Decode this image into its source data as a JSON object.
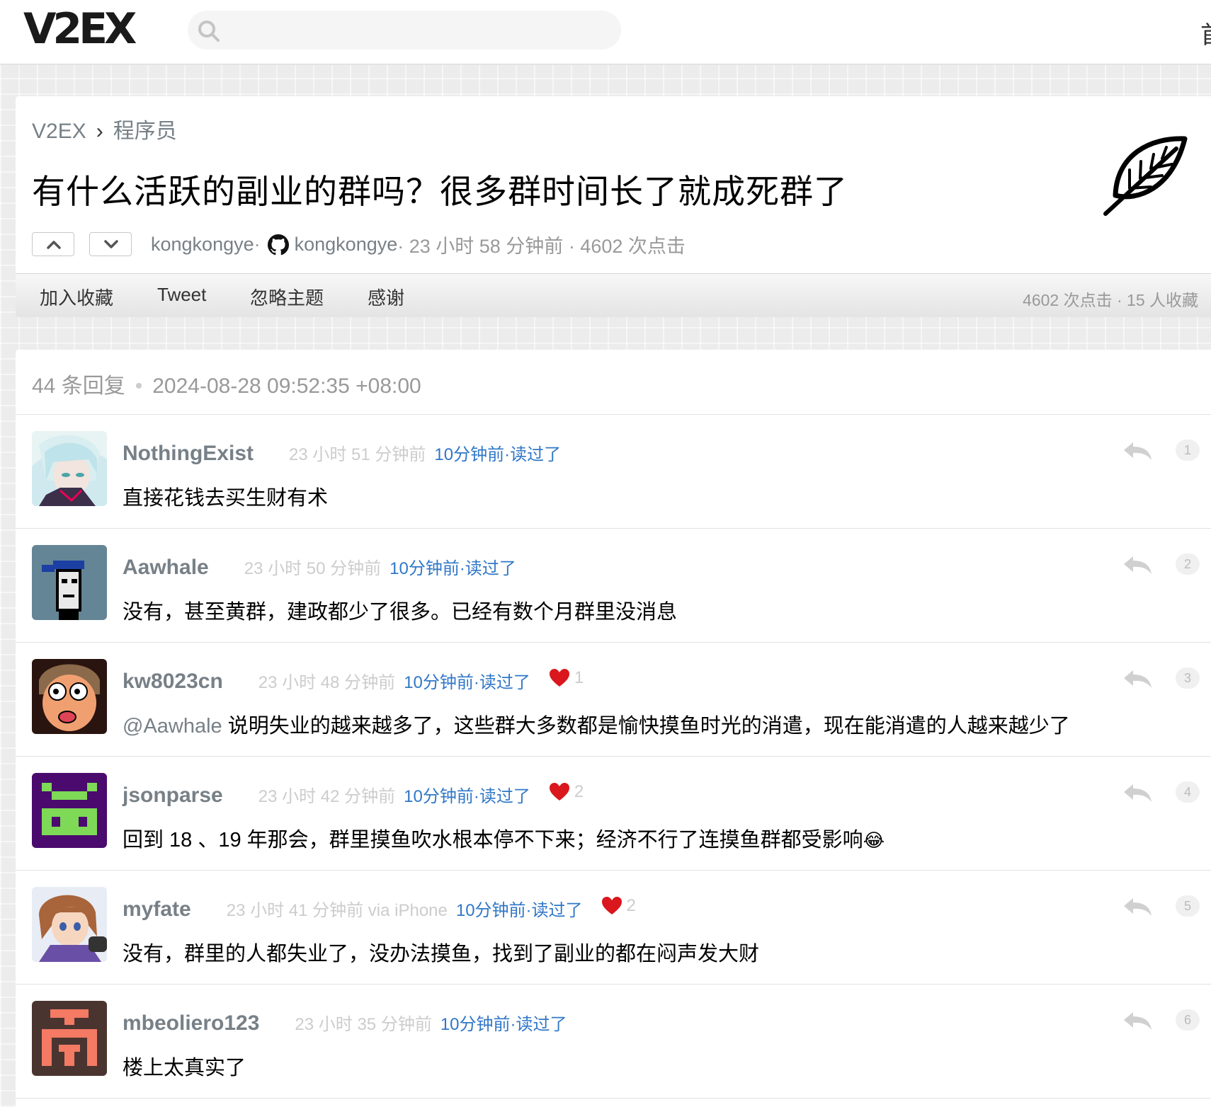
{
  "header": {
    "logo": "V2EX",
    "search_placeholder": "",
    "nav_partial": "首"
  },
  "topic": {
    "breadcrumb_home": "V2EX",
    "breadcrumb_sep": "›",
    "breadcrumb_node": "程序员",
    "title": "有什么活跃的副业的群吗？很多群时间长了就成死群了",
    "author": "kongkongye",
    "github_user": "kongkongye",
    "meta_tail": " · 23 小时 58 分钟前 · 4602 次点击",
    "author_sep": " · ",
    "toolbar": {
      "favorite": "加入收藏",
      "tweet": "Tweet",
      "ignore": "忽略主题",
      "thank": "感谢",
      "stats": "4602 次点击 · 15 人收藏"
    }
  },
  "replies_header": {
    "count": "44 条回复",
    "dot": "•",
    "time": "2024-08-28 09:52:35 +08:00"
  },
  "replies": [
    {
      "user": "NothingExist",
      "time": "23 小时 51 分钟前",
      "read": "10分钟前·读过了",
      "hearts": "",
      "mention": "",
      "content": "直接花钱去买生财有术",
      "num": "1"
    },
    {
      "user": "Aawhale",
      "time": "23 小时 50 分钟前",
      "read": "10分钟前·读过了",
      "hearts": "",
      "mention": "",
      "content": "没有，甚至黄群，建政都少了很多。已经有数个月群里没消息",
      "num": "2"
    },
    {
      "user": "kw8023cn",
      "time": "23 小时 48 分钟前",
      "read": "10分钟前·读过了",
      "hearts": "1",
      "mention": "@Aawhale",
      "content": " 说明失业的越来越多了，这些群大多数都是愉快摸鱼时光的消遣，现在能消遣的人越来越少了",
      "num": "3"
    },
    {
      "user": "jsonparse",
      "time": "23 小时 42 分钟前",
      "read": "10分钟前·读过了",
      "hearts": "2",
      "mention": "",
      "content": "回到 18 、19 年那会，群里摸鱼吹水根本停不下来；经济不行了连摸鱼群都受影响",
      "emoji": "😂",
      "num": "4"
    },
    {
      "user": "myfate",
      "time": "23 小时 41 分钟前 via iPhone",
      "read": "10分钟前·读过了",
      "hearts": "2",
      "mention": "",
      "content": "没有，群里的人都失业了，没办法摸鱼，找到了副业的都在闷声发大财",
      "num": "5"
    },
    {
      "user": "mbeoliero123",
      "time": "23 小时 35 分钟前",
      "read": "10分钟前·读过了",
      "hearts": "",
      "mention": "",
      "content": "楼上太真实了",
      "num": "6"
    }
  ]
}
